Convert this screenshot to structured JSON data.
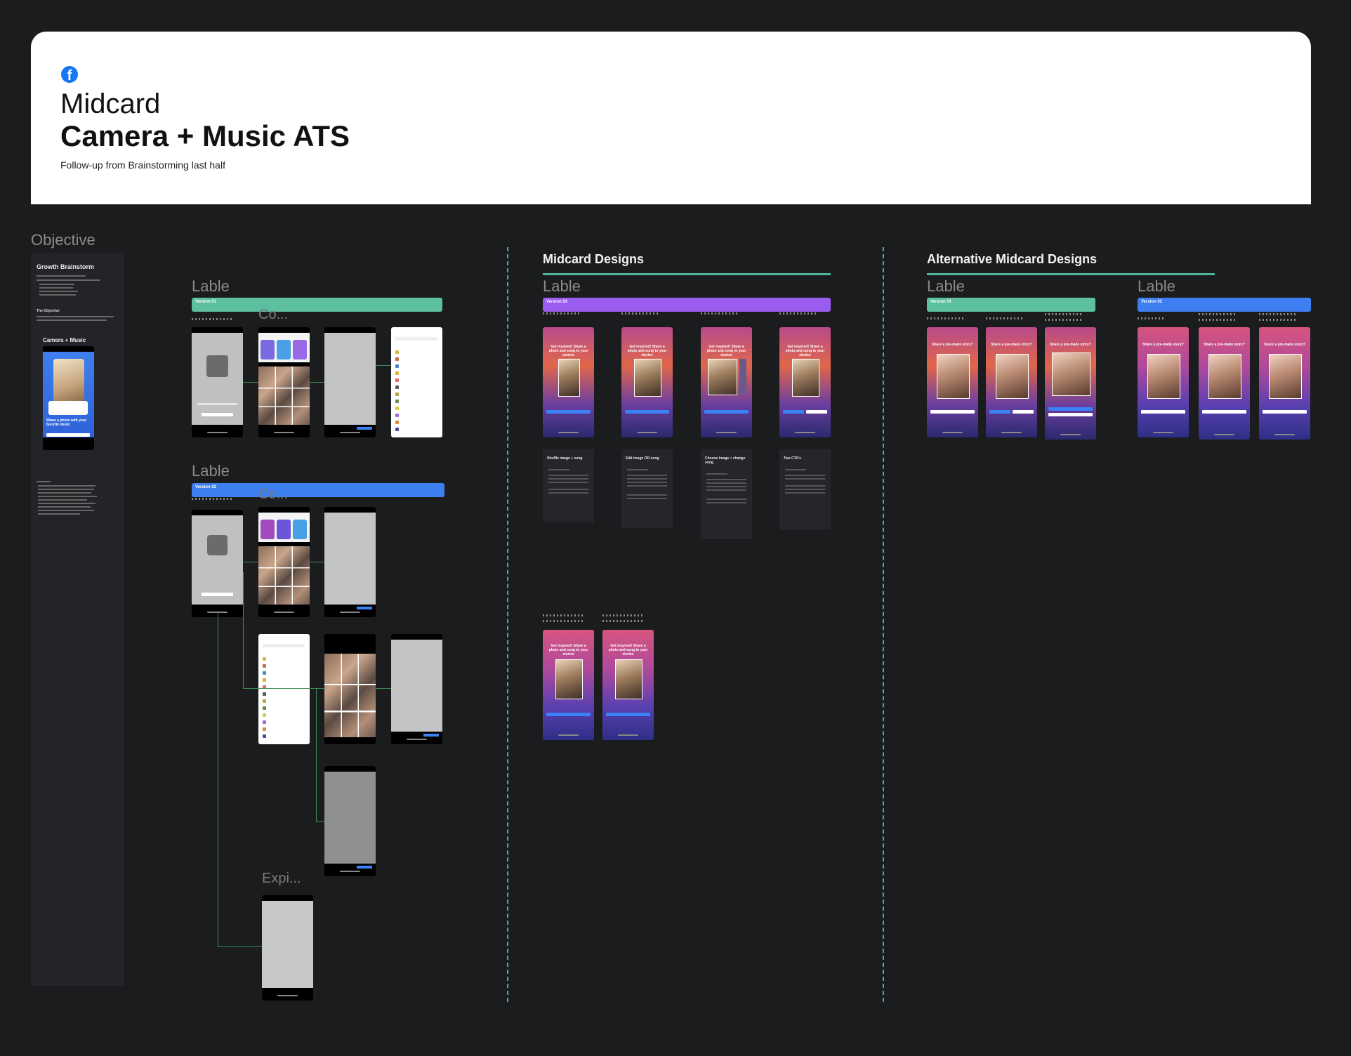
{
  "header": {
    "logo_icon": "facebook-icon",
    "logo_glyph": "f",
    "project": "Midcard",
    "title": "Camera + Music ATS",
    "subtitle": "Follow-up from Brainstorming last half"
  },
  "objective": {
    "label": "Objective",
    "heading": "Growth Brainstorm",
    "goal_heading": "The Objective",
    "card_title": "Camera + Music",
    "card_prompt": "Share a photo with your favorite music"
  },
  "sections": {
    "midcard": "Midcard Designs",
    "alternative": "Alternative Midcard Designs"
  },
  "lable": "Lable",
  "truncated": {
    "co": "Co...",
    "expi": "Expi..."
  },
  "versions": {
    "v1": "Version 01",
    "v2": "Version 02",
    "v3": "Version 03"
  },
  "midcard_headline": "Get inspired! Share a photo and song to your stories",
  "alt_headline": "Share a pre-made story?",
  "cards": [
    {
      "title": "Shuffle image + song"
    },
    {
      "title": "Edit image OR song"
    },
    {
      "title": "Choose image + change song"
    },
    {
      "title": "Two CTA's"
    }
  ],
  "colors": {
    "background": "#1b1c1e",
    "teal": "#5bbfa0",
    "purple": "#9b5cf0",
    "blue": "#3d7ef0",
    "facebook_blue": "#1877f2"
  }
}
